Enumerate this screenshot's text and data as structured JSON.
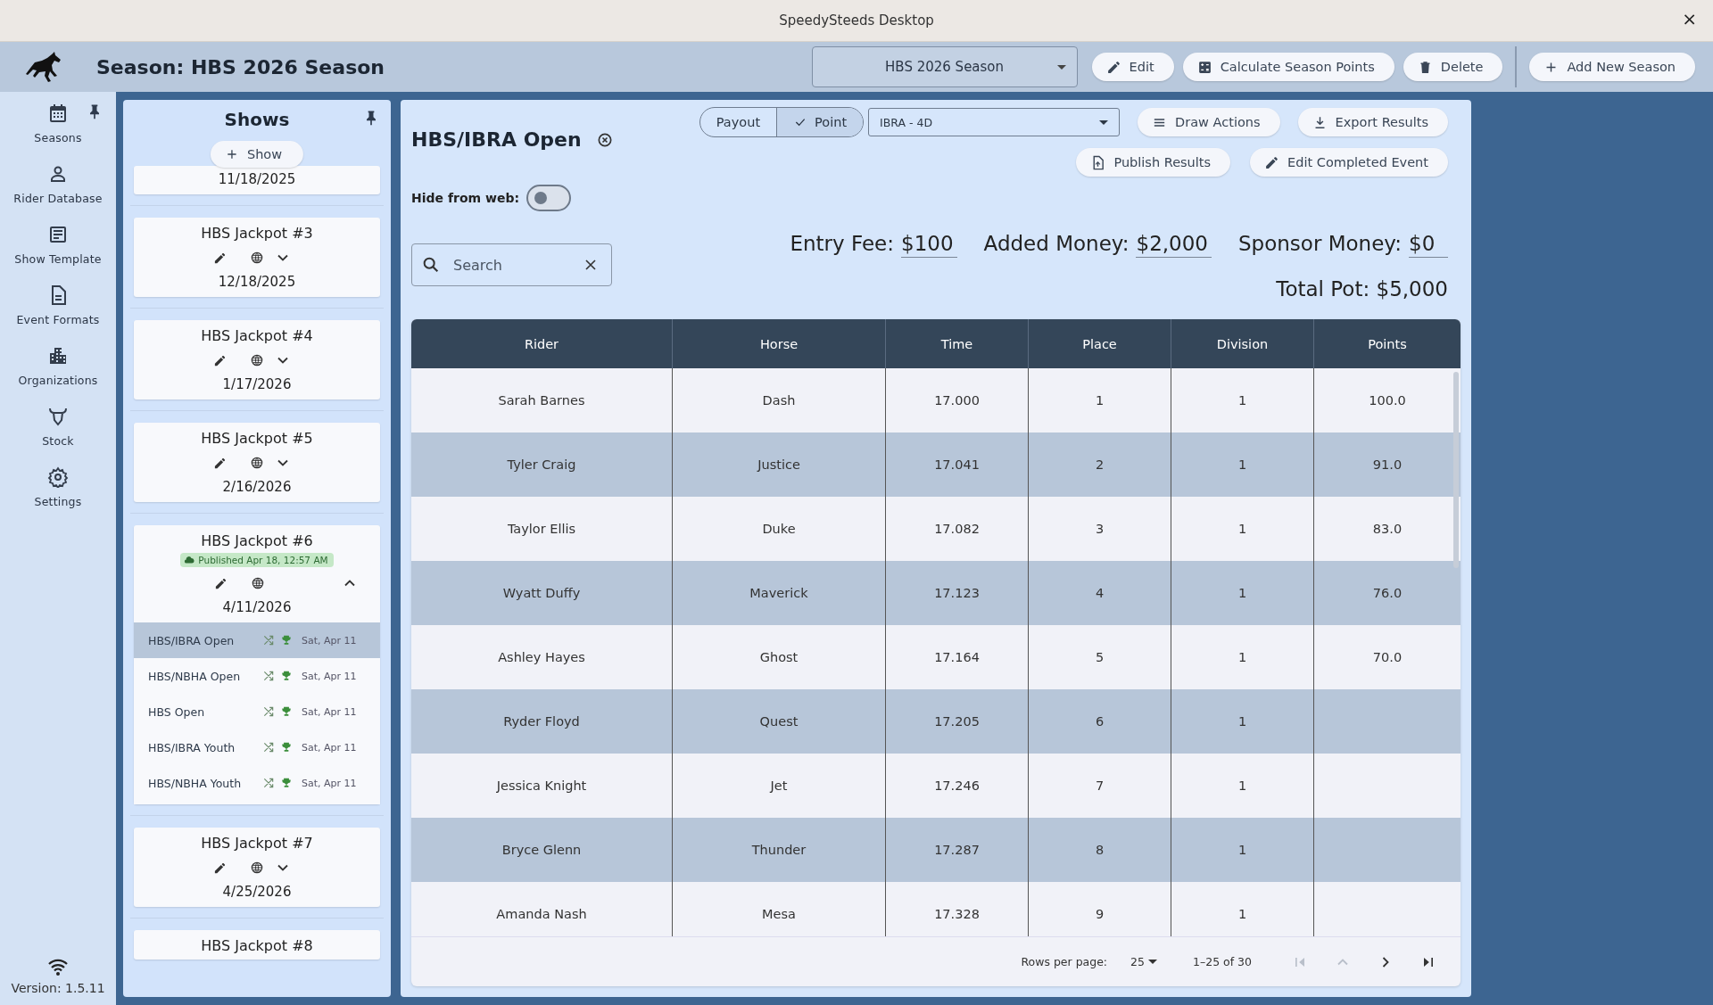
{
  "window": {
    "title": "SpeedySteeds Desktop",
    "close": "×"
  },
  "header": {
    "season_title": "Season: HBS 2026 Season",
    "season_select": "HBS 2026 Season",
    "buttons": [
      "Edit",
      "Calculate Season Points",
      "Delete",
      "Add New Season"
    ]
  },
  "nav": {
    "items": [
      {
        "label": "Seasons"
      },
      {
        "label": "Rider Database"
      },
      {
        "label": "Show Template"
      },
      {
        "label": "Event Formats"
      },
      {
        "label": "Organizations"
      },
      {
        "label": "Stock"
      },
      {
        "label": "Settings"
      }
    ],
    "version": "Version: 1.5.11"
  },
  "shows": {
    "title": "Shows",
    "add_button": "Show",
    "cards": [
      {
        "date": "11/18/2025"
      },
      {
        "title": "HBS Jackpot #3",
        "expanded": false,
        "date": "12/18/2025"
      },
      {
        "title": "HBS Jackpot #4",
        "expanded": false,
        "date": "1/17/2026"
      },
      {
        "title": "HBS Jackpot #5",
        "expanded": false,
        "date": "2/16/2026"
      },
      {
        "title": "HBS Jackpot #6",
        "badge": "Published Apr 18, 12:57 AM",
        "expanded": true,
        "date": "4/11/2026",
        "events": [
          {
            "name": "HBS/IBRA Open",
            "date": "Sat, Apr 11",
            "selected": true
          },
          {
            "name": "HBS/NBHA Open",
            "date": "Sat, Apr 11",
            "selected": false
          },
          {
            "name": "HBS Open",
            "date": "Sat, Apr 11",
            "selected": false
          },
          {
            "name": "HBS/IBRA Youth",
            "date": "Sat, Apr 11",
            "selected": false
          },
          {
            "name": "HBS/NBHA Youth",
            "date": "Sat, Apr 11",
            "selected": false
          }
        ]
      },
      {
        "title": "HBS Jackpot #7",
        "expanded": false,
        "date": "4/25/2026"
      },
      {
        "title": "HBS Jackpot #8"
      }
    ]
  },
  "event": {
    "title": "HBS/IBRA Open",
    "mode_toggle": [
      {
        "label": "Payout",
        "selected": false
      },
      {
        "label": "Point",
        "selected": true
      }
    ],
    "format_select": "IBRA - 4D",
    "actions": [
      "Draw Actions",
      "Export Results",
      "Publish Results",
      "Edit Completed Event"
    ],
    "hide_from_web": {
      "label": "Hide from web:",
      "on": false
    },
    "search": {
      "placeholder": "Search"
    },
    "money": [
      {
        "label": "Entry Fee:",
        "currency": "$",
        "value": "100"
      },
      {
        "label": "Added Money:",
        "currency": "$",
        "value": "2,000"
      },
      {
        "label": "Sponsor Money:",
        "currency": "$",
        "value": "0"
      }
    ],
    "total_pot": "Total Pot: $5,000",
    "table": {
      "columns": [
        "Rider",
        "Horse",
        "Time",
        "Place",
        "Division",
        "Points"
      ],
      "rows": [
        [
          "Sarah Barnes",
          "Dash",
          "17.000",
          "1",
          "1",
          "100.0"
        ],
        [
          "Tyler Craig",
          "Justice",
          "17.041",
          "2",
          "1",
          "91.0"
        ],
        [
          "Taylor Ellis",
          "Duke",
          "17.082",
          "3",
          "1",
          "83.0"
        ],
        [
          "Wyatt Duffy",
          "Maverick",
          "17.123",
          "4",
          "1",
          "76.0"
        ],
        [
          "Ashley Hayes",
          "Ghost",
          "17.164",
          "5",
          "1",
          "70.0"
        ],
        [
          "Ryder Floyd",
          "Quest",
          "17.205",
          "6",
          "1"
        ],
        [
          "Jessica Knight",
          "Jet",
          "17.246",
          "7",
          "1"
        ],
        [
          "Bryce Glenn",
          "Thunder",
          "17.287",
          "8",
          "1"
        ],
        [
          "Amanda Nash",
          "Mesa",
          "17.328",
          "9",
          "1"
        ]
      ]
    },
    "pagination": {
      "rows_per_page_label": "Rows per page:",
      "rows_per_page": "25",
      "range": "1–25 of 30"
    }
  }
}
